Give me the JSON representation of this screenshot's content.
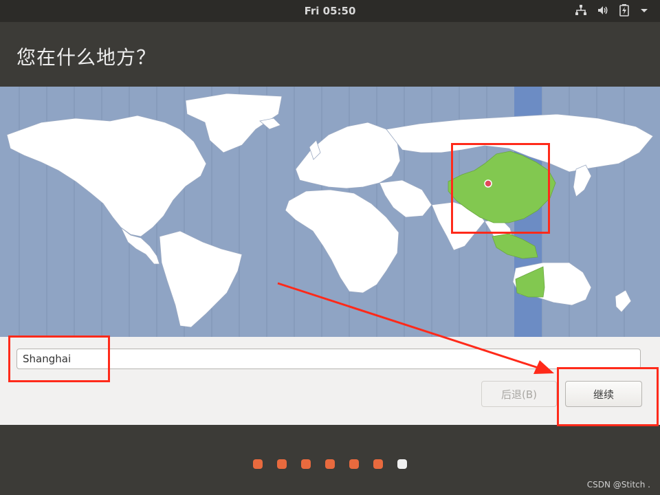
{
  "topbar": {
    "clock": "Fri 05:50",
    "icons": [
      "network-icon",
      "volume-icon",
      "battery-icon",
      "chevron-down-icon"
    ]
  },
  "title": "您在什么地方？",
  "map": {
    "ocean_color": "#8fa4c4",
    "land_color": "#ffffff",
    "selected_region_color": "#82c850",
    "timezone_band_color": "#6c8cc4",
    "pin_color": "#e04a5a"
  },
  "location_input": {
    "value": "Shanghai"
  },
  "buttons": {
    "back": "后退(B)",
    "continue": "继续"
  },
  "progress": {
    "total": 7,
    "current": 7
  },
  "annotation_color": "#ff2a1a",
  "watermark": "CSDN @Stitch ."
}
